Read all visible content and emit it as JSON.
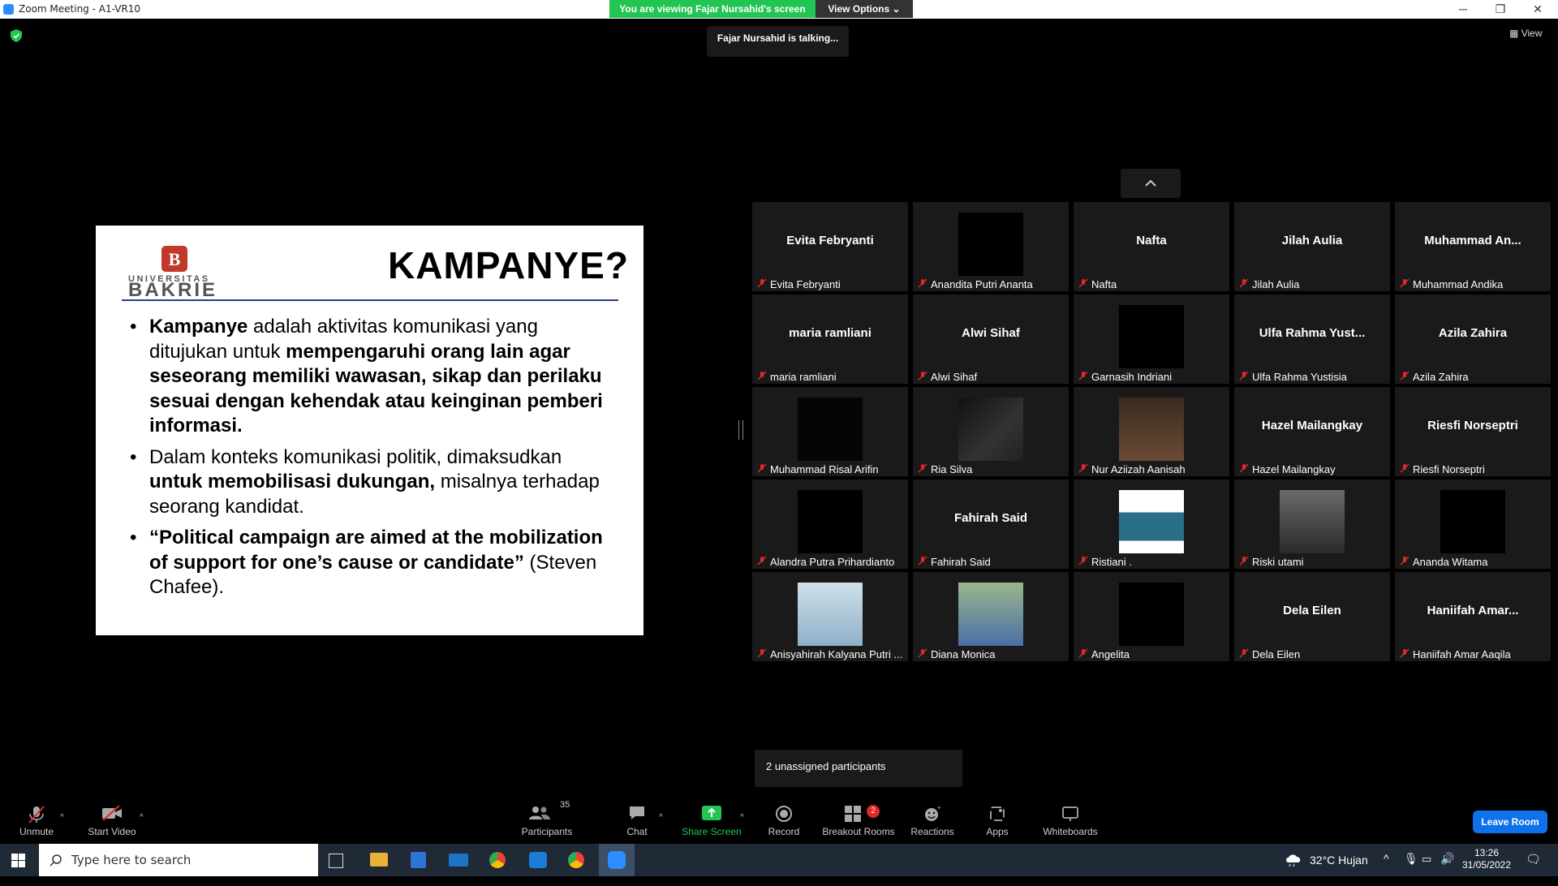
{
  "window": {
    "title": "Zoom Meeting - A1-VR10",
    "viewing_banner": "You are viewing Fajar Nursahid's screen",
    "view_options": "View Options",
    "talking_toast": "Fajar Nursahid is talking...",
    "view_label": "View"
  },
  "slide": {
    "title": "KAMPANYE?",
    "logo_top": "UNIVERSITAS",
    "logo_bottom": "BAKRIE",
    "b1_bold1": "Kampanye",
    "b1_text1": " adalah aktivitas komunikasi yang ditujukan untuk ",
    "b1_bold2": "mempengaruhi orang lain agar seseorang memiliki wawasan, sikap dan perilaku sesuai dengan kehendak atau keinginan pemberi informasi.",
    "b2_text1": "Dalam konteks komunikasi politik, dimaksudkan ",
    "b2_bold1": "untuk memobilisasi dukungan,",
    "b2_text2": " misalnya terhadap seorang kandidat.",
    "b3_bold1": "“Political campaign are aimed at the mobilization of support for one’s cause or candidate”",
    "b3_text1": " (Steven Chafee)."
  },
  "gallery": {
    "participants": [
      {
        "center": "Evita Febryanti",
        "label": "Evita Febryanti"
      },
      {
        "center": "",
        "label": "Anandita Putri Ananta"
      },
      {
        "center": "Nafta",
        "label": "Nafta"
      },
      {
        "center": "Jilah Aulia",
        "label": "Jilah Aulia"
      },
      {
        "center": "Muhammad  An...",
        "label": "Muhammad Andika"
      },
      {
        "center": "maria ramliani",
        "label": "maria ramliani"
      },
      {
        "center": "Alwi Sihaf",
        "label": "Alwi Sihaf"
      },
      {
        "center": "",
        "label": "Garnasih Indriani"
      },
      {
        "center": "Ulfa Rahma Yust...",
        "label": "Ulfa Rahma Yustisia"
      },
      {
        "center": "Azila Zahira",
        "label": "Azila Zahira"
      },
      {
        "center": "",
        "label": "Muhammad Risal Arifin"
      },
      {
        "center": "",
        "label": "Ria Silva"
      },
      {
        "center": "",
        "label": "Nur Aziizah Aanisah"
      },
      {
        "center": "Hazel Mailangkay",
        "label": "Hazel Mailangkay"
      },
      {
        "center": "Riesfi Norseptri",
        "label": "Riesfi Norseptri"
      },
      {
        "center": "",
        "label": "Alandra Putra Prihardianto"
      },
      {
        "center": "Fahirah Said",
        "label": "Fahirah Said"
      },
      {
        "center": "",
        "label": "Ristiani ."
      },
      {
        "center": "",
        "label": "Riski utami"
      },
      {
        "center": "",
        "label": "Ananda Witama"
      },
      {
        "center": "",
        "label": "Anisyahirah Kalyana Putri ..."
      },
      {
        "center": "",
        "label": "Diana Monica"
      },
      {
        "center": "",
        "label": "Angelita"
      },
      {
        "center": "Dela Eilen",
        "label": "Dela Eilen"
      },
      {
        "center": "Haniifah  Amar...",
        "label": "Haniifah Amar Aaqila"
      }
    ],
    "unassigned": "2 unassigned participants"
  },
  "toolbar": {
    "unmute": "Unmute",
    "start_video": "Start Video",
    "participants": "Participants",
    "participants_count": "35",
    "chat": "Chat",
    "share_screen": "Share Screen",
    "record": "Record",
    "breakout_rooms": "Breakout Rooms",
    "breakout_badge": "2",
    "reactions": "Reactions",
    "apps": "Apps",
    "whiteboards": "Whiteboards",
    "leave_room": "Leave Room"
  },
  "taskbar": {
    "search_placeholder": "Type here to search",
    "weather": "32°C  Hujan",
    "time": "13:26",
    "date": "31/05/2022"
  },
  "colors": {
    "green": "#23c552",
    "accent_blue": "#0e72ed",
    "mic_red": "#e02828"
  }
}
